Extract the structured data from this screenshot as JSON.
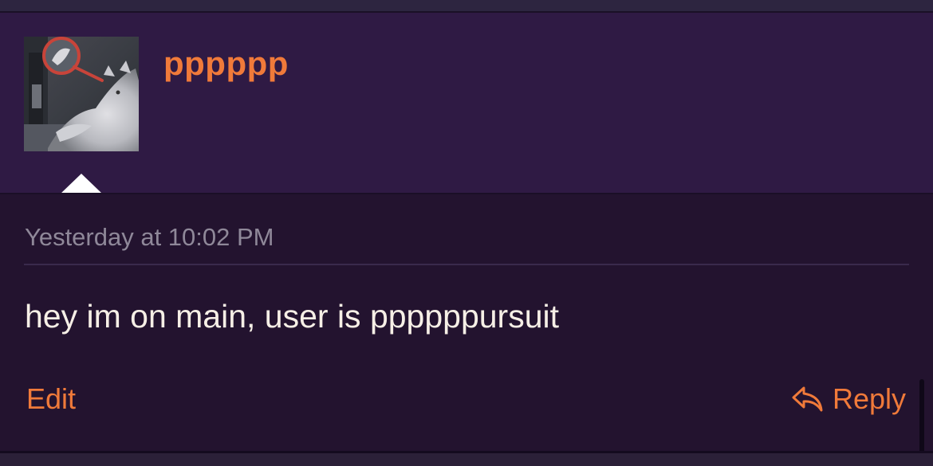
{
  "post": {
    "username": "pppppp",
    "timestamp": "Yesterday at 10:02 PM",
    "message": "hey im on main, user is ppppppursuit",
    "actions": {
      "edit_label": "Edit",
      "reply_label": "Reply"
    }
  },
  "colors": {
    "accent": "#f07a3a",
    "header_bg": "#2f1a44",
    "body_bg": "#23132f",
    "text": "#f6efe6",
    "muted": "#8f8899"
  },
  "icons": {
    "reply": "reply-arrow-icon",
    "avatar": "cat-avatar-image"
  }
}
